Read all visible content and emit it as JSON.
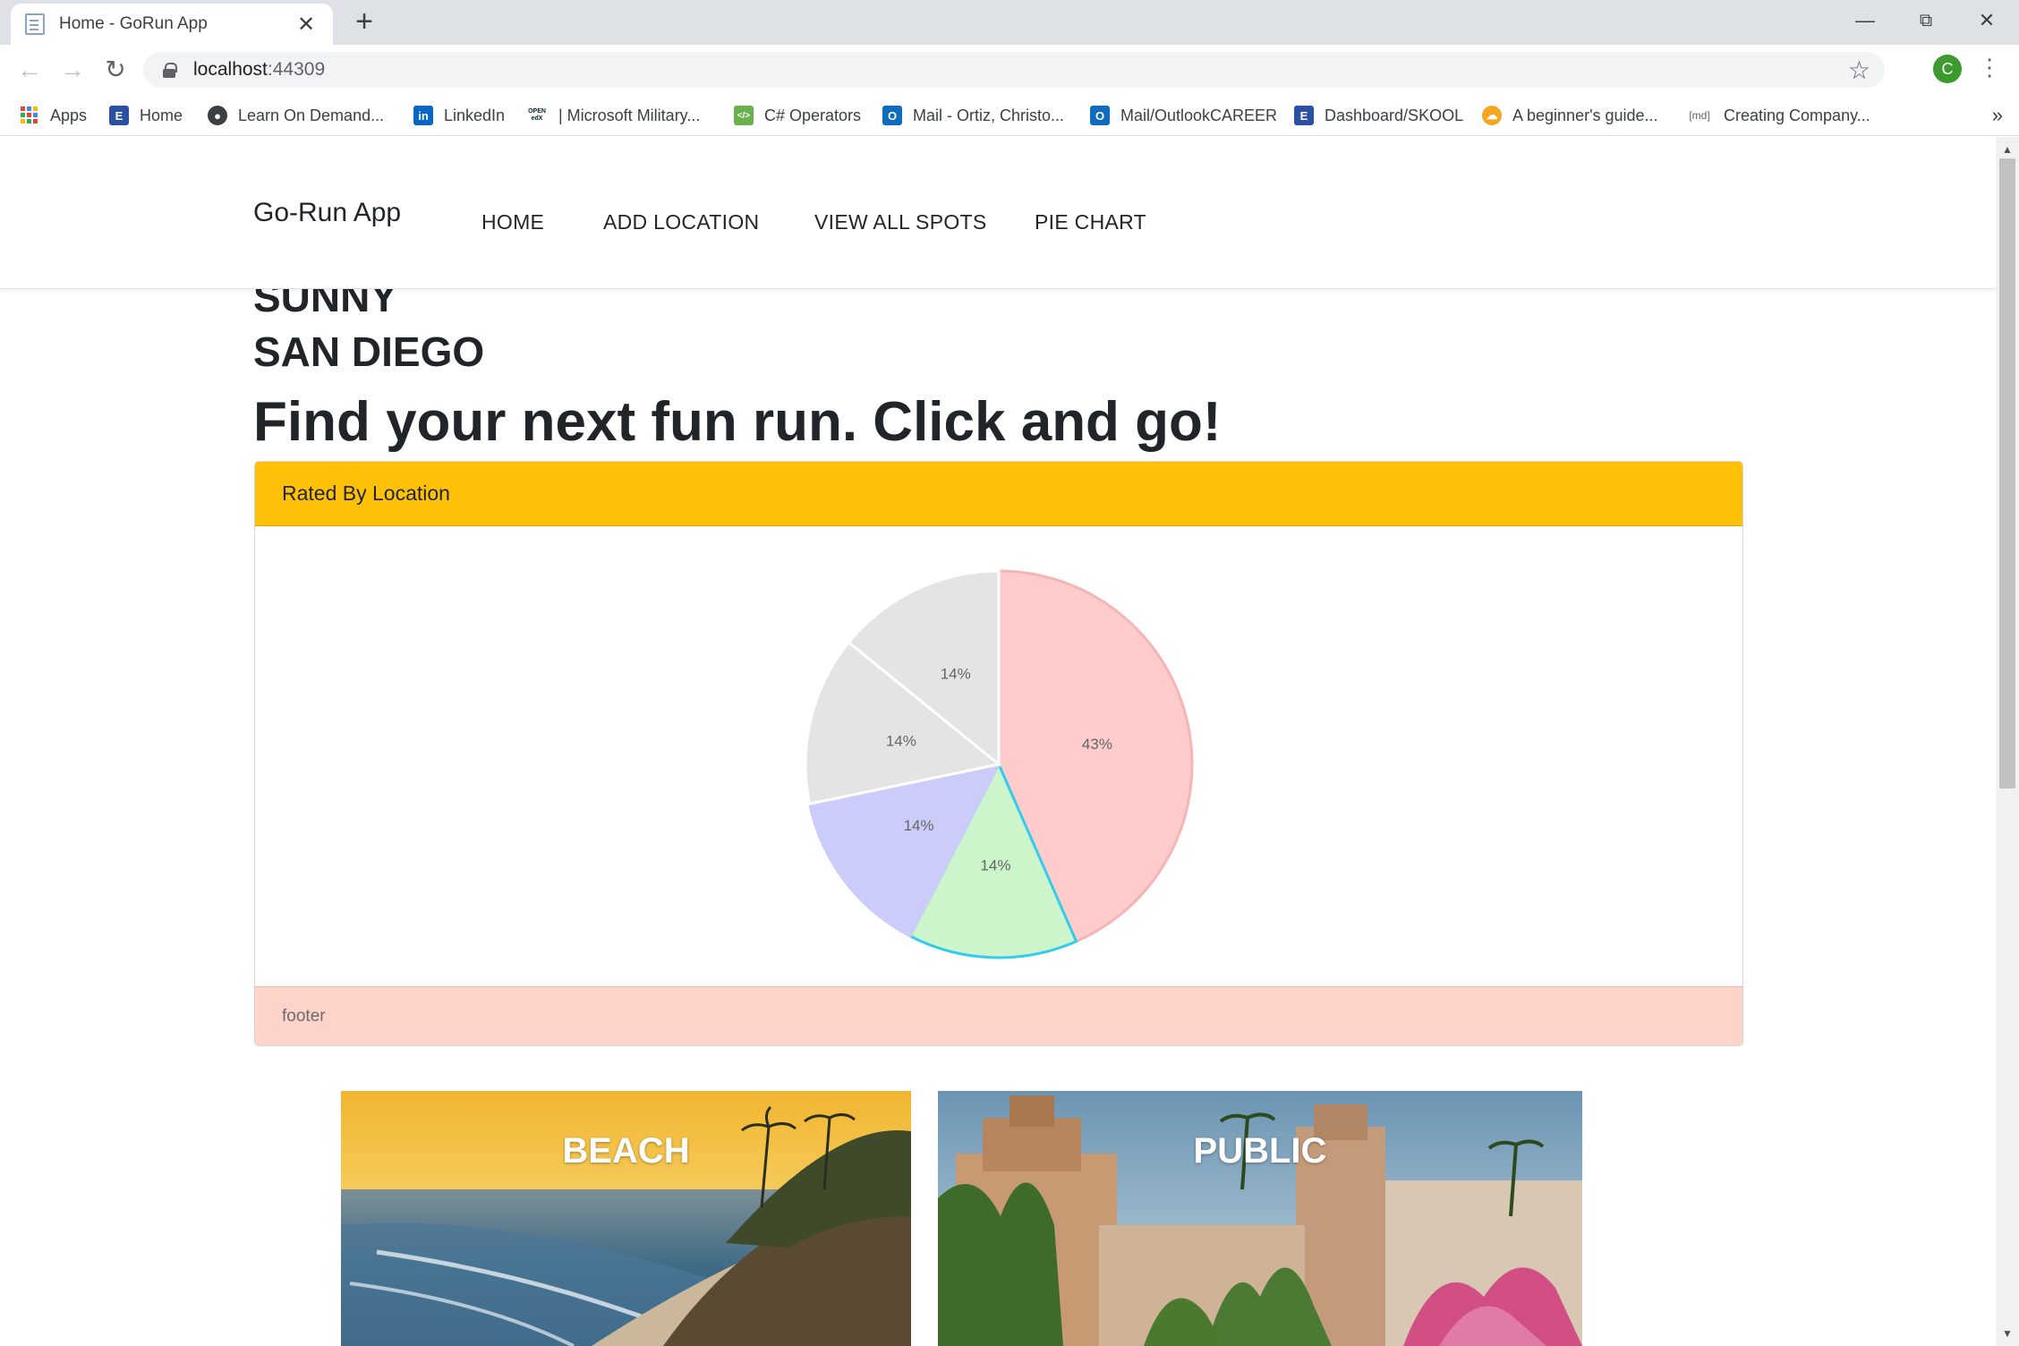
{
  "browser": {
    "tab_title": "Home - GoRun App",
    "url_host": "localhost",
    "url_port": ":44309",
    "profile_initial": "C",
    "bookmarks": [
      {
        "label": "Apps"
      },
      {
        "label": "Home"
      },
      {
        "label": "Learn On Demand..."
      },
      {
        "label": "LinkedIn"
      },
      {
        "label": "| Microsoft Military..."
      },
      {
        "label": "C# Operators"
      },
      {
        "label": "Mail - Ortiz, Christo..."
      },
      {
        "label": "Mail/OutlookCAREER"
      },
      {
        "label": "Dashboard/SKOOL"
      },
      {
        "label": "A beginner's guide..."
      },
      {
        "label": "Creating Company..."
      }
    ],
    "bookmark_icon_texts": {
      "linkedin": "in",
      "edx": "OPEN edX",
      "csharp": "</>",
      "md": "[md]"
    }
  },
  "site": {
    "brand": "Go-Run App",
    "nav": [
      "HOME",
      "ADD LOCATION",
      "VIEW ALL SPOTS",
      "PIE CHART"
    ]
  },
  "hero": {
    "line1": "SUNNY",
    "line2": "SAN DIEGO",
    "tagline": "Find your next fun run. Click and go!"
  },
  "card": {
    "header": "Rated By Location",
    "footer": "footer"
  },
  "chart_data": {
    "type": "pie",
    "title": "",
    "labels": [
      "43%",
      "14%",
      "14%",
      "14%",
      "14%"
    ],
    "values": [
      43,
      14,
      14,
      14,
      14
    ],
    "colors": [
      "#ffcccc",
      "#ccf5cc",
      "#ccccfa",
      "#e4e4e4",
      "#e4e4e4"
    ],
    "border_colors": [
      "#f5b5b5",
      "#33ccee",
      "#ccccfa",
      "#ffffff",
      "#ffffff"
    ]
  },
  "tiles": [
    {
      "label": "BEACH"
    },
    {
      "label": "PUBLIC"
    }
  ]
}
